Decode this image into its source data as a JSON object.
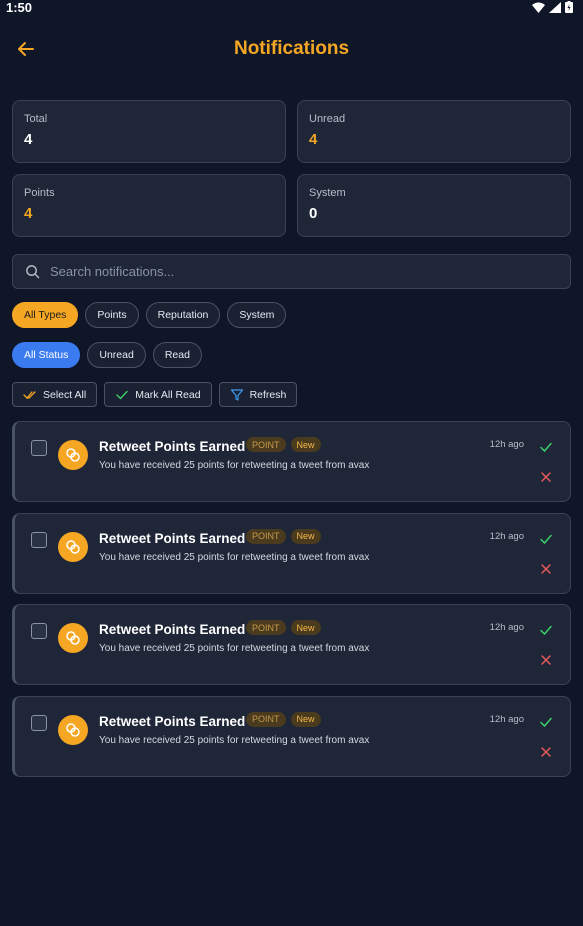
{
  "status_bar": {
    "time": "1:50"
  },
  "header": {
    "title": "Notifications"
  },
  "stats": [
    {
      "label": "Total",
      "value": "4",
      "accent": false
    },
    {
      "label": "Unread",
      "value": "4",
      "accent": true
    },
    {
      "label": "Points",
      "value": "4",
      "accent": true
    },
    {
      "label": "System",
      "value": "0",
      "accent": false
    }
  ],
  "search": {
    "placeholder": "Search notifications..."
  },
  "type_filters": [
    "All Types",
    "Points",
    "Reputation",
    "System"
  ],
  "status_filters": [
    "All Status",
    "Unread",
    "Read"
  ],
  "actions": {
    "select_all": "Select All",
    "mark_all_read": "Mark All Read",
    "refresh": "Refresh"
  },
  "notifications": [
    {
      "title": "Retweet Points Earned",
      "type_badge": "POINT",
      "new_badge": "New",
      "message": "You have received 25 points for retweeting a tweet from avax",
      "time": "12h ago"
    },
    {
      "title": "Retweet Points Earned",
      "type_badge": "POINT",
      "new_badge": "New",
      "message": "You have received 25 points for retweeting a tweet from avax",
      "time": "12h ago"
    },
    {
      "title": "Retweet Points Earned",
      "type_badge": "POINT",
      "new_badge": "New",
      "message": "You have received 25 points for retweeting a tweet from avax",
      "time": "12h ago"
    },
    {
      "title": "Retweet Points Earned",
      "type_badge": "POINT",
      "new_badge": "New",
      "message": "You have received 25 points for retweeting a tweet from avax",
      "time": "12h ago"
    }
  ],
  "colors": {
    "accent": "#f5a623",
    "active_blue": "#3a7bf0",
    "background": "#0f1628",
    "card": "#1e2638",
    "success": "#3ecf6a",
    "danger": "#e85a5a"
  }
}
